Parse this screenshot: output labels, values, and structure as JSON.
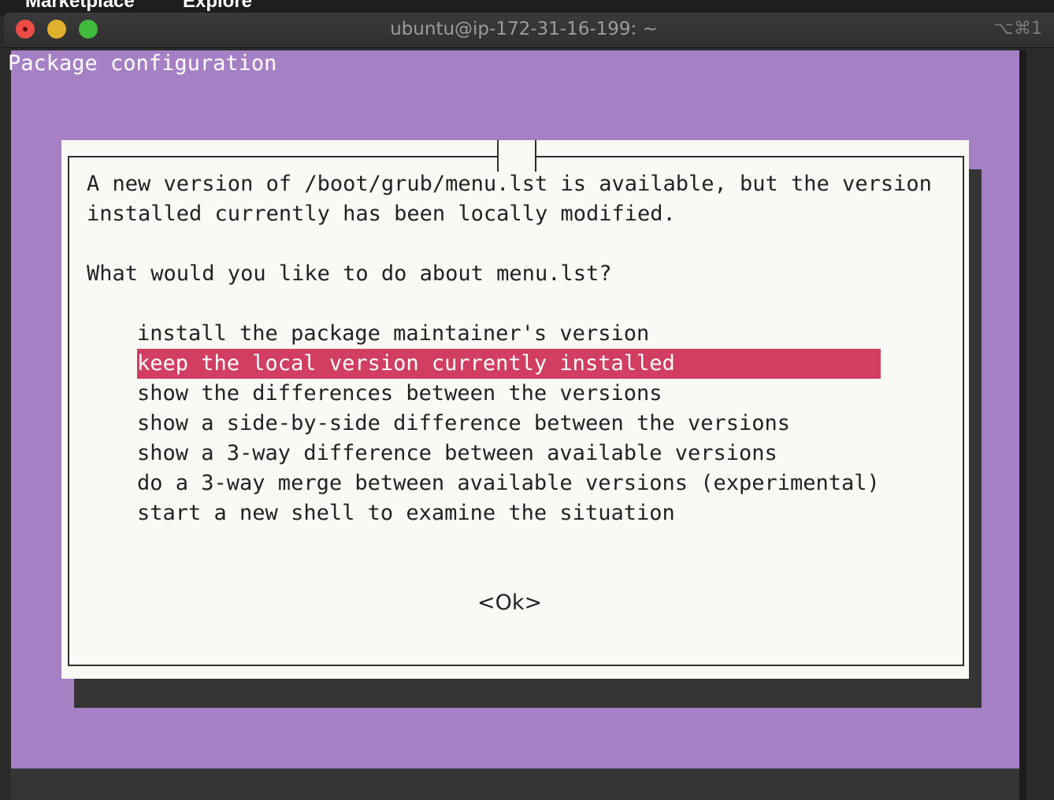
{
  "background_page": {
    "nav_items": [
      "Marketplace",
      "Explore"
    ]
  },
  "window": {
    "title": "ubuntu@ip-172-31-16-199: ~",
    "shortcut": "⌥⌘1",
    "traffic_lights": {
      "close": "#ec4c46",
      "minimize": "#dfb02c",
      "maximize": "#3fba3c"
    }
  },
  "terminal": {
    "background_color": "#a680c4",
    "header": "Package configuration",
    "dialog": {
      "message_line1": "A new version of /boot/grub/menu.lst is available, but the version",
      "message_line2": "installed currently has been locally modified.",
      "question": "What would you like to do about menu.lst?",
      "options": [
        "install the package maintainer's version",
        "keep the local version currently installed",
        "show the differences between the versions",
        "show a side-by-side difference between the versions",
        "show a 3-way difference between available versions",
        "do a 3-way merge between available versions (experimental)",
        "start a new shell to examine the situation"
      ],
      "selected_index": 1,
      "selection_color": "#d13e62",
      "ok_label": "<Ok>"
    }
  }
}
